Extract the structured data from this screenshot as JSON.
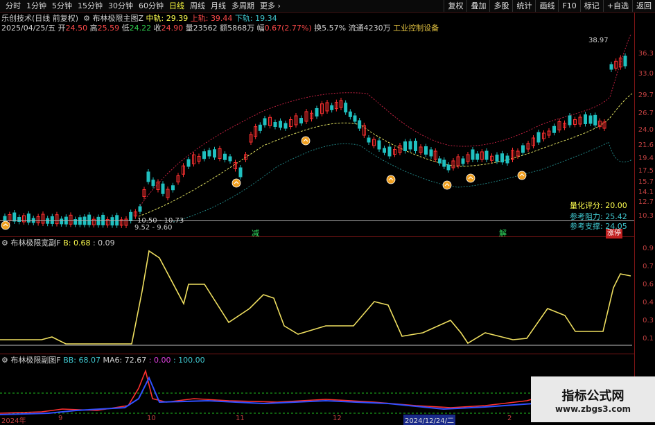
{
  "toolbar": {
    "periods": [
      "分时",
      "1分钟",
      "5分钟",
      "15分钟",
      "30分钟",
      "60分钟",
      "日线",
      "周线",
      "月线",
      "多周期",
      "更多 ›"
    ],
    "active_period": "日线",
    "right_buttons": [
      "复权",
      "叠加",
      "多股",
      "统计",
      "画线",
      "F10",
      "标记",
      "+自选",
      "返回"
    ]
  },
  "main_header": {
    "title": "乐创技术(日线 前复权)",
    "indicator": "布林极限主图Z",
    "mid_label": "中轨:",
    "mid_value": "29.39",
    "upper_label": "上轨:",
    "upper_value": "39.44",
    "lower_label": "下轨:",
    "lower_value": "19.34"
  },
  "quote_line": {
    "date": "2025/04/25/五",
    "open_label": "开",
    "open": "24.50",
    "high_label": "高",
    "high": "25.59",
    "low_label": "低",
    "low": "24.22",
    "close_label": "收",
    "close": "24.90",
    "vol_label": "量",
    "vol": "23562",
    "amt_label": "额",
    "amt": "5868万",
    "chg_label": "幅",
    "chg": "0.67(2.77%)",
    "turnover_label": "换",
    "turnover": "5.57%",
    "float_label": "流通",
    "float": "4230万",
    "industry": "工业控制设备"
  },
  "main_axis": [
    "36.3",
    "33.0",
    "29.7",
    "26.7",
    "24.0",
    "21.6",
    "19.4",
    "17.5",
    "15.7",
    "14.1",
    "12.7",
    "10.3"
  ],
  "main_annotations": {
    "high_mark": "38.97",
    "low_range1": "10.50 - 10.73",
    "low_range2": "9.52 - 9.60",
    "sig_reduce": "减",
    "sig_release": "解",
    "sig_limit": "涨停"
  },
  "score": {
    "score_label": "量化评分:",
    "score": "20.00",
    "resist_label": "参考阻力:",
    "resist": "25.42",
    "support_label": "参考支撑:",
    "support": "24.05"
  },
  "sub1": {
    "title": "布林极限宽副F",
    "b_label": "B:",
    "b_value": "0.68",
    "b_extra": ": 0.09",
    "axis": [
      "0.9",
      "0.7",
      "0.6",
      "0.4",
      "0.3",
      "0.1"
    ]
  },
  "sub2": {
    "title": "布林极限副图F",
    "bb_label": "BB:",
    "bb_value": "68.07",
    "ma6_label": "MA6:",
    "ma6_value": "72.67",
    "v1": ": 0.00",
    "v2": ": 100.00"
  },
  "dates": [
    "2024年",
    "9",
    "10",
    "11",
    "12",
    "2024/12/24/二",
    "2"
  ],
  "watermark": {
    "line1": "指标公式网",
    "line2": "www.zbgs3.com"
  },
  "colors": {
    "up": "#ff3030",
    "down": "#20c0c0",
    "bull": "#ffff40",
    "accent": "#c04040"
  }
}
